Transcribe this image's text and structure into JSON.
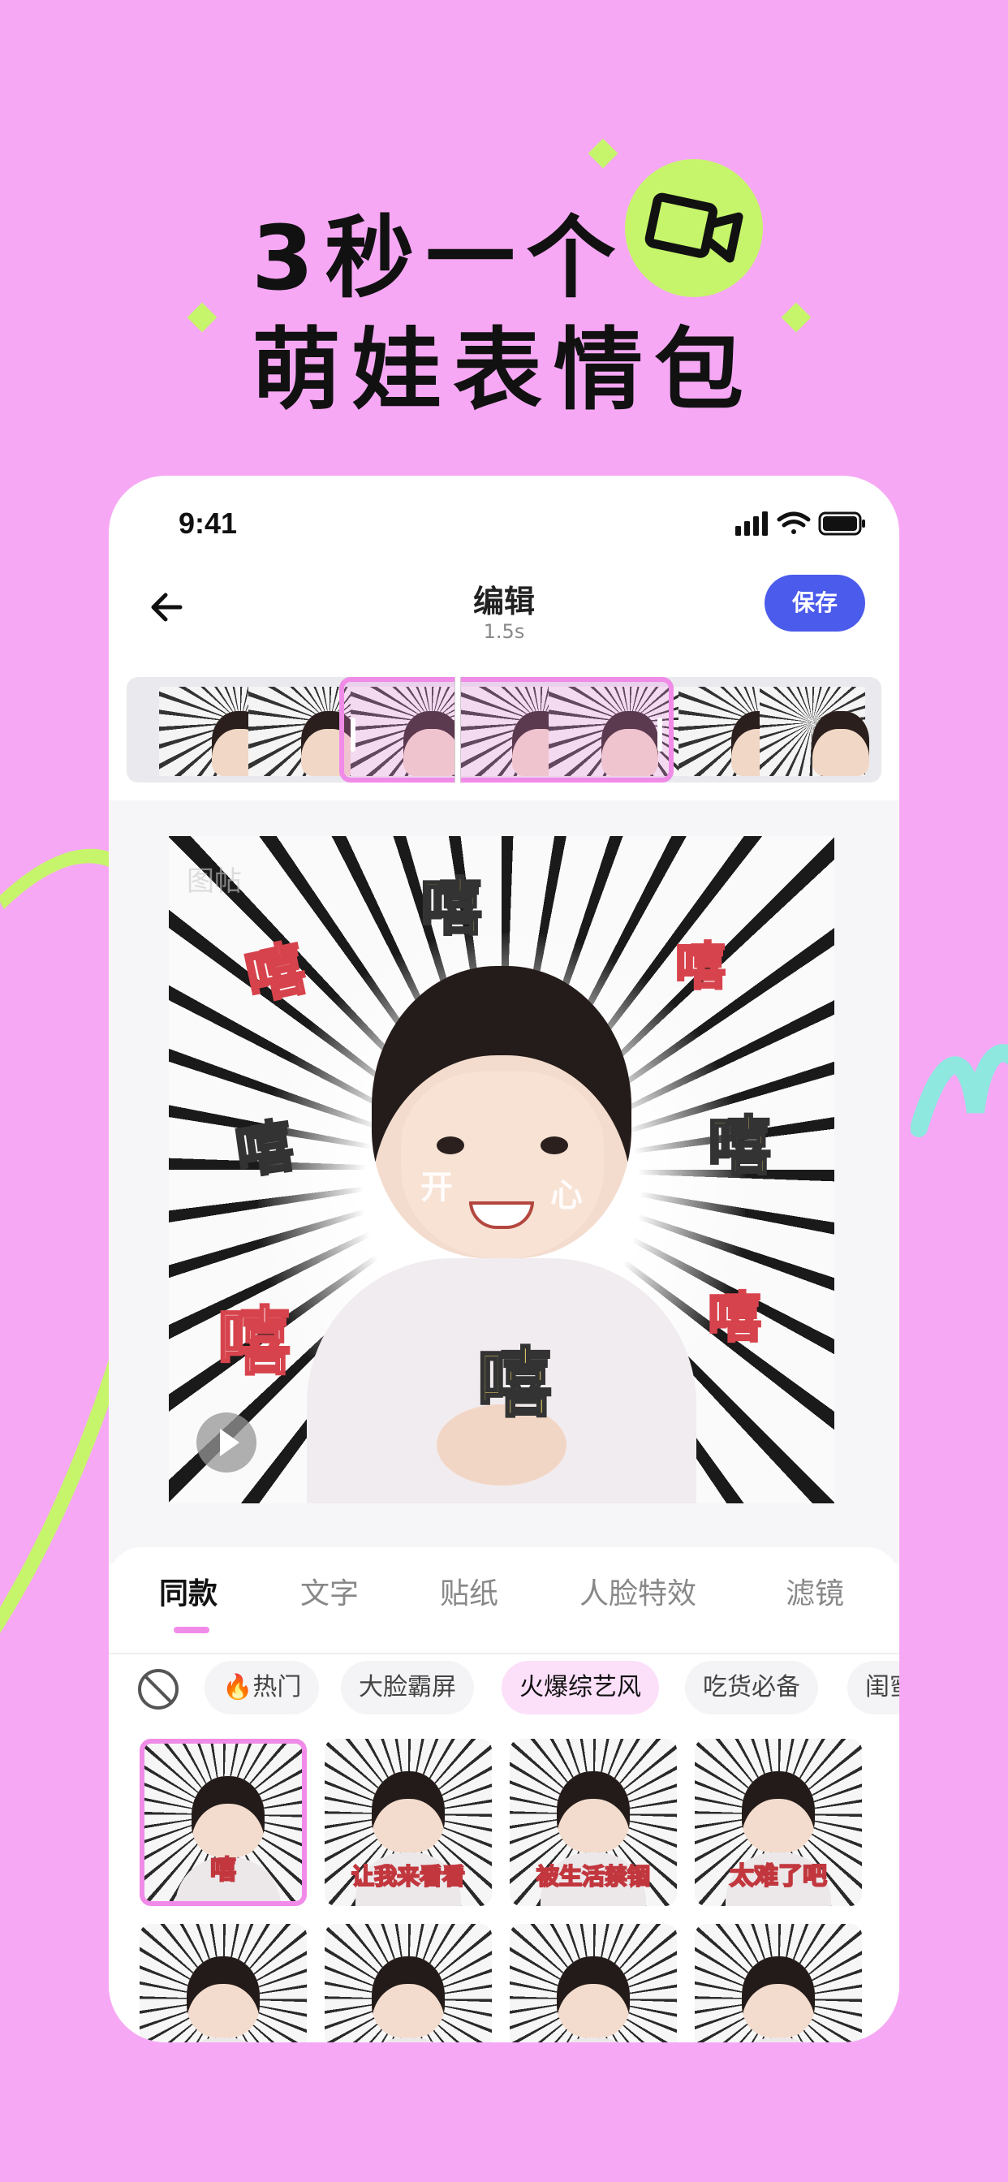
{
  "headline": {
    "line1": "3秒一个",
    "line2": "萌娃表情包"
  },
  "colors": {
    "background": "#F6A8F4",
    "accent_green": "#C6F56B",
    "save_button": "#4B5BEB",
    "selection_pink": "#F08BE8"
  },
  "status_bar": {
    "time": "9:41"
  },
  "nav": {
    "title": "编辑",
    "subtitle": "1.5s",
    "save_label": "保存"
  },
  "preview": {
    "watermark": "图帖",
    "sticker_word": "嘻",
    "face_words": [
      "开",
      "心"
    ]
  },
  "tabs": [
    {
      "label": "同款",
      "active": true
    },
    {
      "label": "文字",
      "active": false
    },
    {
      "label": "贴纸",
      "active": false
    },
    {
      "label": "人脸特效",
      "active": false
    },
    {
      "label": "滤镜",
      "active": false
    }
  ],
  "categories": [
    {
      "label": "🔥热门",
      "active": false
    },
    {
      "label": "大脸霸屏",
      "active": false
    },
    {
      "label": "火爆综艺风",
      "active": true
    },
    {
      "label": "吃货必备",
      "active": false
    },
    {
      "label": "闺蜜",
      "active": false
    }
  ],
  "templates": [
    {
      "caption": "嘻",
      "selected": true
    },
    {
      "caption": "让我来看看",
      "selected": false
    },
    {
      "caption": "被生活禁锢",
      "selected": false
    },
    {
      "caption": "太难了吧",
      "selected": false
    },
    {
      "caption": "",
      "selected": false
    },
    {
      "caption": "",
      "selected": false
    },
    {
      "caption": "",
      "selected": false
    },
    {
      "caption": "",
      "selected": false
    }
  ]
}
